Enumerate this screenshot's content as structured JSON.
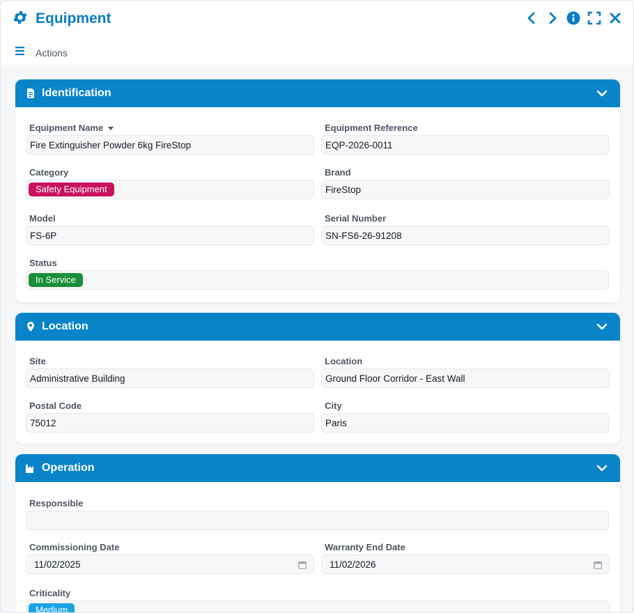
{
  "header": {
    "title": "Equipment",
    "actions_label": "Actions"
  },
  "colors": {
    "accent": "#0984c8",
    "safety_tag": "#c8125e",
    "service_tag": "#1a8f3a",
    "medium_tag": "#1aa4e6"
  },
  "icons": {
    "title": "gear-icon",
    "prev": "chevron-left-icon",
    "next": "chevron-right-icon",
    "info": "info-icon",
    "expand": "expand-icon",
    "close": "close-icon",
    "menu": "hamburger-icon"
  },
  "sections": {
    "identification": {
      "title": "Identification",
      "fields": {
        "equipment_name": {
          "label": "Equipment Name",
          "value": "Fire Extinguisher Powder 6kg FireStop"
        },
        "equipment_reference": {
          "label": "Equipment Reference",
          "value": "EQP-2026-0011"
        },
        "category": {
          "label": "Category",
          "value": "Safety Equipment"
        },
        "brand": {
          "label": "Brand",
          "value": "FireStop"
        },
        "model": {
          "label": "Model",
          "value": "FS-6P"
        },
        "serial_number": {
          "label": "Serial Number",
          "value": "SN-FS6-26-91208"
        },
        "status": {
          "label": "Status",
          "value": "In Service"
        }
      }
    },
    "location": {
      "title": "Location",
      "fields": {
        "site": {
          "label": "Site",
          "value": "Administrative Building"
        },
        "location": {
          "label": "Location",
          "value": "Ground Floor Corridor - East Wall"
        },
        "postal_code": {
          "label": "Postal Code",
          "value": "75012"
        },
        "city": {
          "label": "City",
          "value": "Paris"
        }
      }
    },
    "operation": {
      "title": "Operation",
      "fields": {
        "responsible": {
          "label": "Responsible",
          "value": ""
        },
        "commissioning_date": {
          "label": "Commissioning Date",
          "value": "11/02/2025"
        },
        "warranty_end_date": {
          "label": "Warranty End Date",
          "value": "11/02/2026"
        },
        "criticality": {
          "label": "Criticality",
          "value": "Medium"
        }
      }
    }
  }
}
